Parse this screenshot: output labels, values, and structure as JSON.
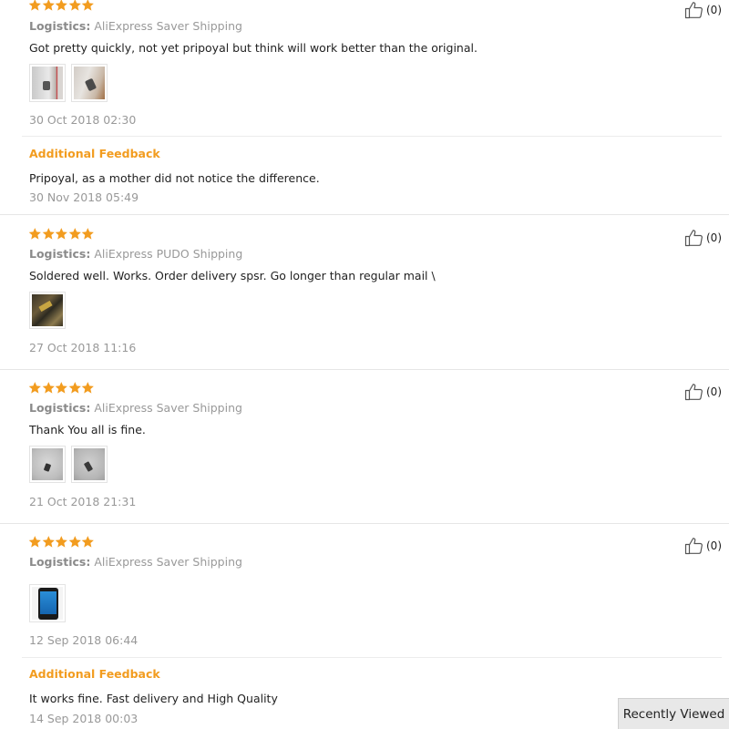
{
  "colors": {
    "star": "#f29c1f",
    "feedback_title": "#f29c1f",
    "muted": "#999999"
  },
  "reviews": [
    {
      "stars": 5,
      "logistics_label": "Logistics:",
      "logistics_value": "AliExpress Saver Shipping",
      "text": "Got pretty quickly, not yet pripoyal but think will work better than the original.",
      "date": "30 Oct 2018 02:30",
      "helpful_count": "(0)",
      "additional_feedback": {
        "title": "Additional Feedback",
        "text": "Pripoyal, as a mother did not notice the difference.",
        "date": "30 Nov 2018 05:49"
      }
    },
    {
      "stars": 5,
      "logistics_label": "Logistics:",
      "logistics_value": "AliExpress PUDO Shipping",
      "text": "Soldered well. Works. Order delivery spsr. Go longer than regular mail \\",
      "date": "27 Oct 2018 11:16",
      "helpful_count": "(0)"
    },
    {
      "stars": 5,
      "logistics_label": "Logistics:",
      "logistics_value": "AliExpress Saver Shipping",
      "text": "Thank You all is fine.",
      "date": "21 Oct 2018 21:31",
      "helpful_count": "(0)"
    },
    {
      "stars": 5,
      "logistics_label": "Logistics:",
      "logistics_value": "AliExpress Saver Shipping",
      "text": "",
      "date": "12 Sep 2018 06:44",
      "helpful_count": "(0)",
      "additional_feedback": {
        "title": "Additional Feedback",
        "text": "It works fine. Fast delivery and High Quality",
        "date": "14 Sep 2018 00:03"
      }
    }
  ],
  "recently_viewed": "Recently Viewed"
}
